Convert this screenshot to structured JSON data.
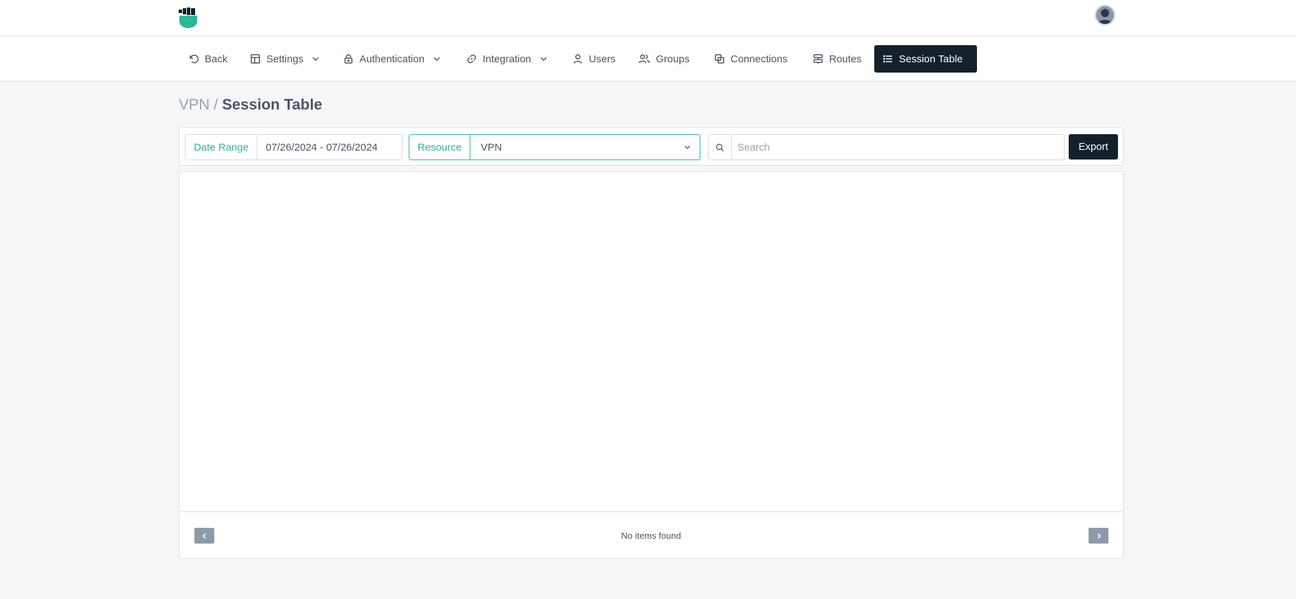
{
  "colors": {
    "accent": "#2bb99a",
    "dark": "#13212b",
    "pager": "#8e9aa8"
  },
  "header": {
    "logo_icon": "fist-shield-logo-icon",
    "avatar_icon": "user-avatar-icon"
  },
  "nav": {
    "back": "Back",
    "settings": "Settings",
    "authentication": "Authentication",
    "integration": "Integration",
    "users": "Users",
    "groups": "Groups",
    "connections": "Connections",
    "routes": "Routes",
    "session_table": "Session Table",
    "active": "Session Table"
  },
  "breadcrumb": {
    "parent": "VPN",
    "separator": "/",
    "current": "Session Table"
  },
  "filters": {
    "date_range_label": "Date Range",
    "date_range_value": "07/26/2024 - 07/26/2024",
    "resource_label": "Resource",
    "resource_value": "VPN",
    "search_placeholder": "Search",
    "search_value": "",
    "export_label": "Export"
  },
  "table": {
    "empty_message": "No items found"
  }
}
